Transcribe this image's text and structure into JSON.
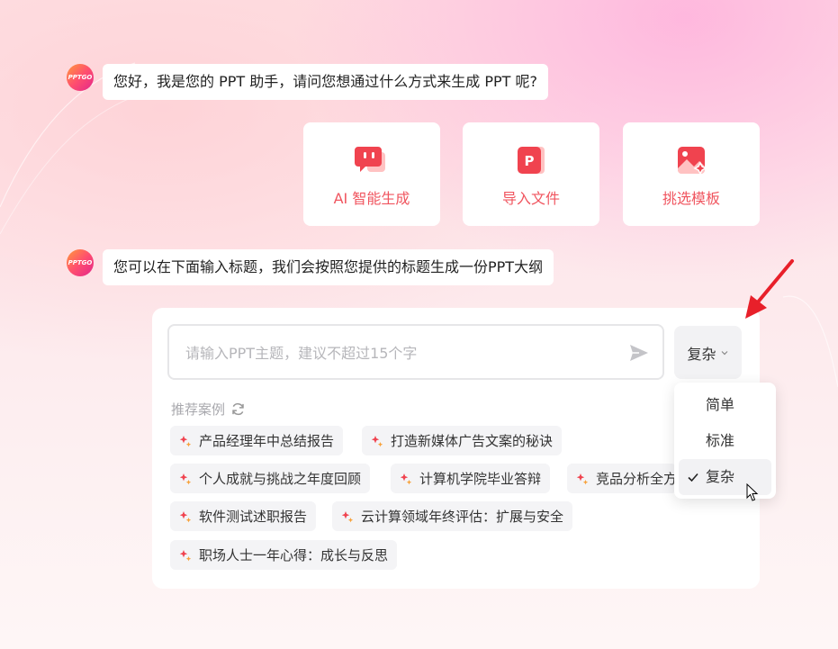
{
  "avatar": {
    "logo_text": "PPTGO"
  },
  "messages": [
    {
      "text": "您好，我是您的 PPT 助手，请问您想通过什么方式来生成 PPT 呢?"
    },
    {
      "text": "您可以在下面输入标题，我们会按照您提供的标题生成一份PPT大纲"
    }
  ],
  "options": [
    {
      "label": "AI 智能生成",
      "icon": "ai-generate-icon"
    },
    {
      "label": "导入文件",
      "icon": "import-file-icon"
    },
    {
      "label": "挑选模板",
      "icon": "template-icon"
    }
  ],
  "input": {
    "placeholder": "请输入PPT主题，建议不超过15个字",
    "value": ""
  },
  "complexity": {
    "selected": "复杂",
    "options": [
      "简单",
      "标准",
      "复杂"
    ]
  },
  "recommend": {
    "title": "推荐案例",
    "items": [
      "产品经理年中总结报告",
      "打造新媒体广告文案的秘诀",
      "个人成就与挑战之年度回顾",
      "计算机学院毕业答辩",
      "竞品分析全方",
      "软件测试述职报告",
      "云计算领域年终评估：扩展与安全",
      "职场人士一年心得：成长与反思"
    ]
  },
  "colors": {
    "accent": "#f0555f",
    "arrow": "#e8202a"
  }
}
